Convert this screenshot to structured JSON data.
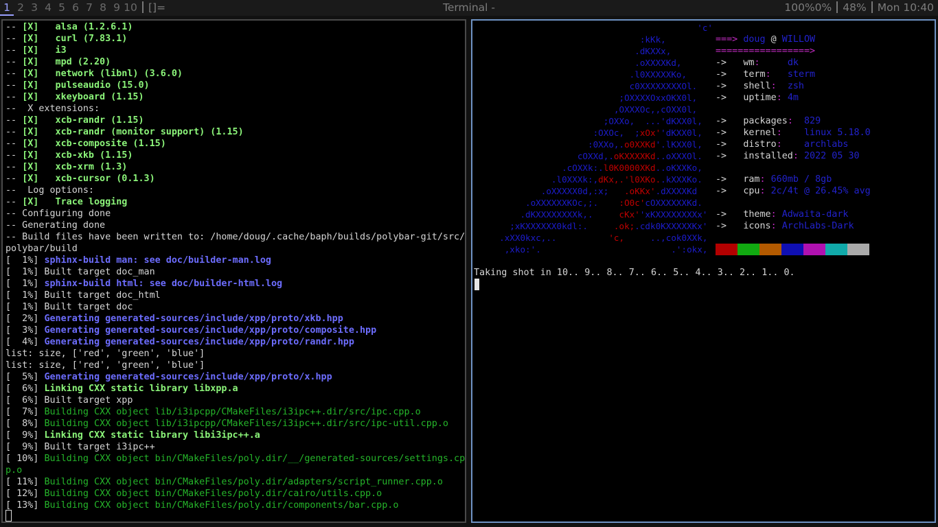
{
  "bar": {
    "workspaces": [
      "1",
      "2",
      "3",
      "4",
      "5",
      "6",
      "7",
      "8",
      "9",
      "10"
    ],
    "active_workspace": "1",
    "layout": "[]=",
    "window_title": "Terminal -",
    "status": [
      "100%0%",
      "48%",
      "Mon 10:40"
    ]
  },
  "left_terminal": {
    "lines": [
      [
        {
          "t": "-- ",
          "c": "w"
        },
        {
          "t": "[X]   alsa (1.2.6.1)",
          "c": "g"
        }
      ],
      [
        {
          "t": "-- ",
          "c": "w"
        },
        {
          "t": "[X]   curl (7.83.1)",
          "c": "g"
        }
      ],
      [
        {
          "t": "-- ",
          "c": "w"
        },
        {
          "t": "[X]   i3",
          "c": "g"
        }
      ],
      [
        {
          "t": "-- ",
          "c": "w"
        },
        {
          "t": "[X]   mpd (2.20)",
          "c": "g"
        }
      ],
      [
        {
          "t": "-- ",
          "c": "w"
        },
        {
          "t": "[X]   network (libnl) (3.6.0)",
          "c": "g"
        }
      ],
      [
        {
          "t": "-- ",
          "c": "w"
        },
        {
          "t": "[X]   pulseaudio (15.0)",
          "c": "g"
        }
      ],
      [
        {
          "t": "-- ",
          "c": "w"
        },
        {
          "t": "[X]   xkeyboard (1.15)",
          "c": "g"
        }
      ],
      [
        {
          "t": "--  X extensions:",
          "c": "w"
        }
      ],
      [
        {
          "t": "-- ",
          "c": "w"
        },
        {
          "t": "[X]   xcb-randr (1.15)",
          "c": "g"
        }
      ],
      [
        {
          "t": "-- ",
          "c": "w"
        },
        {
          "t": "[X]   xcb-randr (monitor support) (1.15)",
          "c": "g"
        }
      ],
      [
        {
          "t": "-- ",
          "c": "w"
        },
        {
          "t": "[X]   xcb-composite (1.15)",
          "c": "g"
        }
      ],
      [
        {
          "t": "-- ",
          "c": "w"
        },
        {
          "t": "[X]   xcb-xkb (1.15)",
          "c": "g"
        }
      ],
      [
        {
          "t": "-- ",
          "c": "w"
        },
        {
          "t": "[X]   xcb-xrm (1.3)",
          "c": "g"
        }
      ],
      [
        {
          "t": "-- ",
          "c": "w"
        },
        {
          "t": "[X]   xcb-cursor (0.1.3)",
          "c": "g"
        }
      ],
      [
        {
          "t": "--  Log options:",
          "c": "w"
        }
      ],
      [
        {
          "t": "-- ",
          "c": "w"
        },
        {
          "t": "[X]   Trace logging",
          "c": "g"
        }
      ],
      [
        {
          "t": "-- Configuring done",
          "c": "w"
        }
      ],
      [
        {
          "t": "-- Generating done",
          "c": "w"
        }
      ],
      [
        {
          "t": "-- Build files have been written to: /home/doug/.cache/baph/builds/polybar-git/src/",
          "c": "w"
        }
      ],
      [
        {
          "t": "polybar/build",
          "c": "w"
        }
      ],
      [
        {
          "t": "[  1%] ",
          "c": "w"
        },
        {
          "t": "sphinx-build man: see doc/builder-man.log",
          "c": "bl"
        }
      ],
      [
        {
          "t": "[  1%] Built target doc_man",
          "c": "w"
        }
      ],
      [
        {
          "t": "[  1%] ",
          "c": "w"
        },
        {
          "t": "sphinx-build html: see doc/builder-html.log",
          "c": "bl"
        }
      ],
      [
        {
          "t": "[  1%] Built target doc_html",
          "c": "w"
        }
      ],
      [
        {
          "t": "[  1%] Built target doc",
          "c": "w"
        }
      ],
      [
        {
          "t": "[  2%] ",
          "c": "w"
        },
        {
          "t": "Generating generated-sources/include/xpp/proto/xkb.hpp",
          "c": "bl"
        }
      ],
      [
        {
          "t": "[  3%] ",
          "c": "w"
        },
        {
          "t": "Generating generated-sources/include/xpp/proto/composite.hpp",
          "c": "bl"
        }
      ],
      [
        {
          "t": "[  4%] ",
          "c": "w"
        },
        {
          "t": "Generating generated-sources/include/xpp/proto/randr.hpp",
          "c": "bl"
        }
      ],
      [
        {
          "t": "list: size, ['red', 'green', 'blue']",
          "c": "w"
        }
      ],
      [
        {
          "t": "list: size, ['red', 'green', 'blue']",
          "c": "w"
        }
      ],
      [
        {
          "t": "[  5%] ",
          "c": "w"
        },
        {
          "t": "Generating generated-sources/include/xpp/proto/x.hpp",
          "c": "bl"
        }
      ],
      [
        {
          "t": "[  6%] ",
          "c": "w"
        },
        {
          "t": "Linking CXX static library libxpp.a",
          "c": "g"
        }
      ],
      [
        {
          "t": "[  6%] Built target xpp",
          "c": "w"
        }
      ],
      [
        {
          "t": "[  7%] ",
          "c": "w"
        },
        {
          "t": "Building CXX object lib/i3ipcpp/CMakeFiles/i3ipc++.dir/src/ipc.cpp.o",
          "c": "dg"
        }
      ],
      [
        {
          "t": "[  8%] ",
          "c": "w"
        },
        {
          "t": "Building CXX object lib/i3ipcpp/CMakeFiles/i3ipc++.dir/src/ipc-util.cpp.o",
          "c": "dg"
        }
      ],
      [
        {
          "t": "[  9%] ",
          "c": "w"
        },
        {
          "t": "Linking CXX static library libi3ipc++.a",
          "c": "g"
        }
      ],
      [
        {
          "t": "[  9%] Built target i3ipc++",
          "c": "w"
        }
      ],
      [
        {
          "t": "[ 10%] ",
          "c": "w"
        },
        {
          "t": "Building CXX object bin/CMakeFiles/poly.dir/__/generated-sources/settings.cp",
          "c": "dg"
        }
      ],
      [
        {
          "t": "p.o",
          "c": "dg"
        }
      ],
      [
        {
          "t": "[ 11%] ",
          "c": "w"
        },
        {
          "t": "Building CXX object bin/CMakeFiles/poly.dir/adapters/script_runner.cpp.o",
          "c": "dg"
        }
      ],
      [
        {
          "t": "[ 12%] ",
          "c": "w"
        },
        {
          "t": "Building CXX object bin/CMakeFiles/poly.dir/cairo/utils.cpp.o",
          "c": "dg"
        }
      ],
      [
        {
          "t": "[ 13%] ",
          "c": "w"
        },
        {
          "t": "Building CXX object bin/CMakeFiles/poly.dir/components/bar.cpp.o",
          "c": "dg"
        }
      ]
    ]
  },
  "right_terminal": {
    "art": [
      [
        {
          "t": "'c'",
          "c": "b"
        }
      ],
      [
        {
          "t": ":kKk,         ",
          "c": "b"
        }
      ],
      [
        {
          "t": ".dKXXx,        ",
          "c": "b"
        }
      ],
      [
        {
          "t": ".oXXXXKd,      ",
          "c": "b"
        }
      ],
      [
        {
          "t": ".l0XXXXXKo,     ",
          "c": "b"
        }
      ],
      [
        {
          "t": "c0XXXXXXXXOl.   ",
          "c": "b"
        }
      ],
      [
        {
          "t": ";OXXXXOxxOKX0l,   ",
          "c": "b"
        }
      ],
      [
        {
          "t": ",OXXXOc,,cOXX0l,   ",
          "c": "b"
        }
      ],
      [
        {
          "t": ";OXXo,  ...'dKXX0l,  ",
          "c": "b"
        }
      ],
      [
        {
          "t": ":OXOc,  ;",
          "c": "b"
        },
        {
          "t": "xOx'",
          "c": "r"
        },
        {
          "t": "'dKXX0l,  ",
          "c": "b"
        }
      ],
      [
        {
          "t": ":0XXo,.",
          "c": "b"
        },
        {
          "t": "o0XXKd",
          "c": "r"
        },
        {
          "t": "'.lKXX0l,  ",
          "c": "b"
        }
      ],
      [
        {
          "t": "cOXXd,.",
          "c": "b"
        },
        {
          "t": "oKXXXXKd",
          "c": "r"
        },
        {
          "t": "..oXXXOl.  ",
          "c": "b"
        }
      ],
      [
        {
          "t": ".cOXXk:.",
          "c": "b"
        },
        {
          "t": "l0K0000XKd",
          "c": "r"
        },
        {
          "t": "..oKXXKo,  ",
          "c": "b"
        }
      ],
      [
        {
          "t": ".l0XXXk:,",
          "c": "b"
        },
        {
          "t": "dKx,.'l0XKo.",
          "c": "r"
        },
        {
          "t": ".kXXXKo.  ",
          "c": "b"
        }
      ],
      [
        {
          "t": ".oXXXXX0d,:x;   ",
          "c": "b"
        },
        {
          "t": ".oKKx'",
          "c": "r"
        },
        {
          "t": ".dXXXXKd   ",
          "c": "b"
        }
      ],
      [
        {
          "t": ".oXXXXXXKOc,;.    ",
          "c": "b"
        },
        {
          "t": ":O0c'",
          "c": "r"
        },
        {
          "t": "cOXXXXXXKd.  ",
          "c": "b"
        }
      ],
      [
        {
          "t": ".dKXXXXXXXXk,.     ",
          "c": "b"
        },
        {
          "t": "cKx'",
          "c": "r"
        },
        {
          "t": "'xKXXXXXXXXx' ",
          "c": "b"
        }
      ],
      [
        {
          "t": ";xKXXXXXX0kdl:.     ",
          "c": "b"
        },
        {
          "t": ".ok;",
          "c": "r"
        },
        {
          "t": ".cdk0KXXXXXKx' ",
          "c": "b"
        }
      ],
      [
        {
          "t": ".xXX0kxc,..          ",
          "c": "b"
        },
        {
          "t": "'c,",
          "c": "r"
        },
        {
          "t": "     ..,cok0XXk, ",
          "c": "b"
        }
      ],
      [
        {
          "t": ",xko:'.                         .':okx, ",
          "c": "b"
        }
      ]
    ],
    "info": [
      [
        {
          "t": "===> ",
          "c": "mag"
        },
        {
          "t": "doug",
          "c": "blu"
        },
        {
          "t": " @ ",
          "c": "wh"
        },
        {
          "t": "WILLOW",
          "c": "blu"
        }
      ],
      [
        {
          "t": "=================>",
          "c": "mag"
        }
      ],
      [
        {
          "t": "->   ",
          "c": "wh"
        },
        {
          "t": "wm",
          "c": "wh"
        },
        {
          "t": ":     ",
          "c": "mag"
        },
        {
          "t": "dk",
          "c": "blu"
        }
      ],
      [
        {
          "t": "->   ",
          "c": "wh"
        },
        {
          "t": "term",
          "c": "wh"
        },
        {
          "t": ":   ",
          "c": "mag"
        },
        {
          "t": "st",
          "c": "blu"
        },
        {
          "t": "erm",
          "c": "blu"
        }
      ],
      [
        {
          "t": "->   ",
          "c": "wh"
        },
        {
          "t": "shell",
          "c": "wh"
        },
        {
          "t": ":  ",
          "c": "mag"
        },
        {
          "t": "zsh",
          "c": "blu"
        }
      ],
      [
        {
          "t": "->   ",
          "c": "wh"
        },
        {
          "t": "uptime",
          "c": "wh"
        },
        {
          "t": ": ",
          "c": "mag"
        },
        {
          "t": "4m",
          "c": "blu"
        }
      ],
      [
        {
          "t": "",
          "c": "wh"
        }
      ],
      [
        {
          "t": "->   ",
          "c": "wh"
        },
        {
          "t": "packages",
          "c": "wh"
        },
        {
          "t": ":  ",
          "c": "mag"
        },
        {
          "t": "829",
          "c": "blu"
        }
      ],
      [
        {
          "t": "->   ",
          "c": "wh"
        },
        {
          "t": "kernel",
          "c": "wh"
        },
        {
          "t": ":    ",
          "c": "mag"
        },
        {
          "t": "linux 5.18.0",
          "c": "blu"
        }
      ],
      [
        {
          "t": "->   ",
          "c": "wh"
        },
        {
          "t": "distro",
          "c": "wh"
        },
        {
          "t": ":    ",
          "c": "mag"
        },
        {
          "t": "archlabs",
          "c": "blu"
        }
      ],
      [
        {
          "t": "->   ",
          "c": "wh"
        },
        {
          "t": "installed",
          "c": "wh"
        },
        {
          "t": ": ",
          "c": "mag"
        },
        {
          "t": "2022 05 30",
          "c": "blu"
        }
      ],
      [
        {
          "t": "",
          "c": "wh"
        }
      ],
      [
        {
          "t": "->   ",
          "c": "wh"
        },
        {
          "t": "ram",
          "c": "wh"
        },
        {
          "t": ": ",
          "c": "mag"
        },
        {
          "t": "660mb / 8gb",
          "c": "blu"
        }
      ],
      [
        {
          "t": "->   ",
          "c": "wh"
        },
        {
          "t": "cpu",
          "c": "wh"
        },
        {
          "t": ": ",
          "c": "mag"
        },
        {
          "t": "2c/4t @ 26.45% avg",
          "c": "blu"
        }
      ],
      [
        {
          "t": "",
          "c": "wh"
        }
      ],
      [
        {
          "t": "->   ",
          "c": "wh"
        },
        {
          "t": "theme",
          "c": "wh"
        },
        {
          "t": ": ",
          "c": "mag"
        },
        {
          "t": "Adwaita-dark",
          "c": "blu"
        }
      ],
      [
        {
          "t": "->   ",
          "c": "wh"
        },
        {
          "t": "icons",
          "c": "wh"
        },
        {
          "t": ": ",
          "c": "mag"
        },
        {
          "t": "ArchLabs-Dark",
          "c": "blu"
        }
      ]
    ],
    "palette": [
      "#b30000",
      "#11aa11",
      "#b35a00",
      "#0f0fb3",
      "#b011b0",
      "#11aaaa",
      "#aaaaaa"
    ],
    "countdown": "Taking shot in 10.. 9.. 8.. 7.. 6.. 5.. 4.. 3.. 2.. 1.. 0."
  }
}
